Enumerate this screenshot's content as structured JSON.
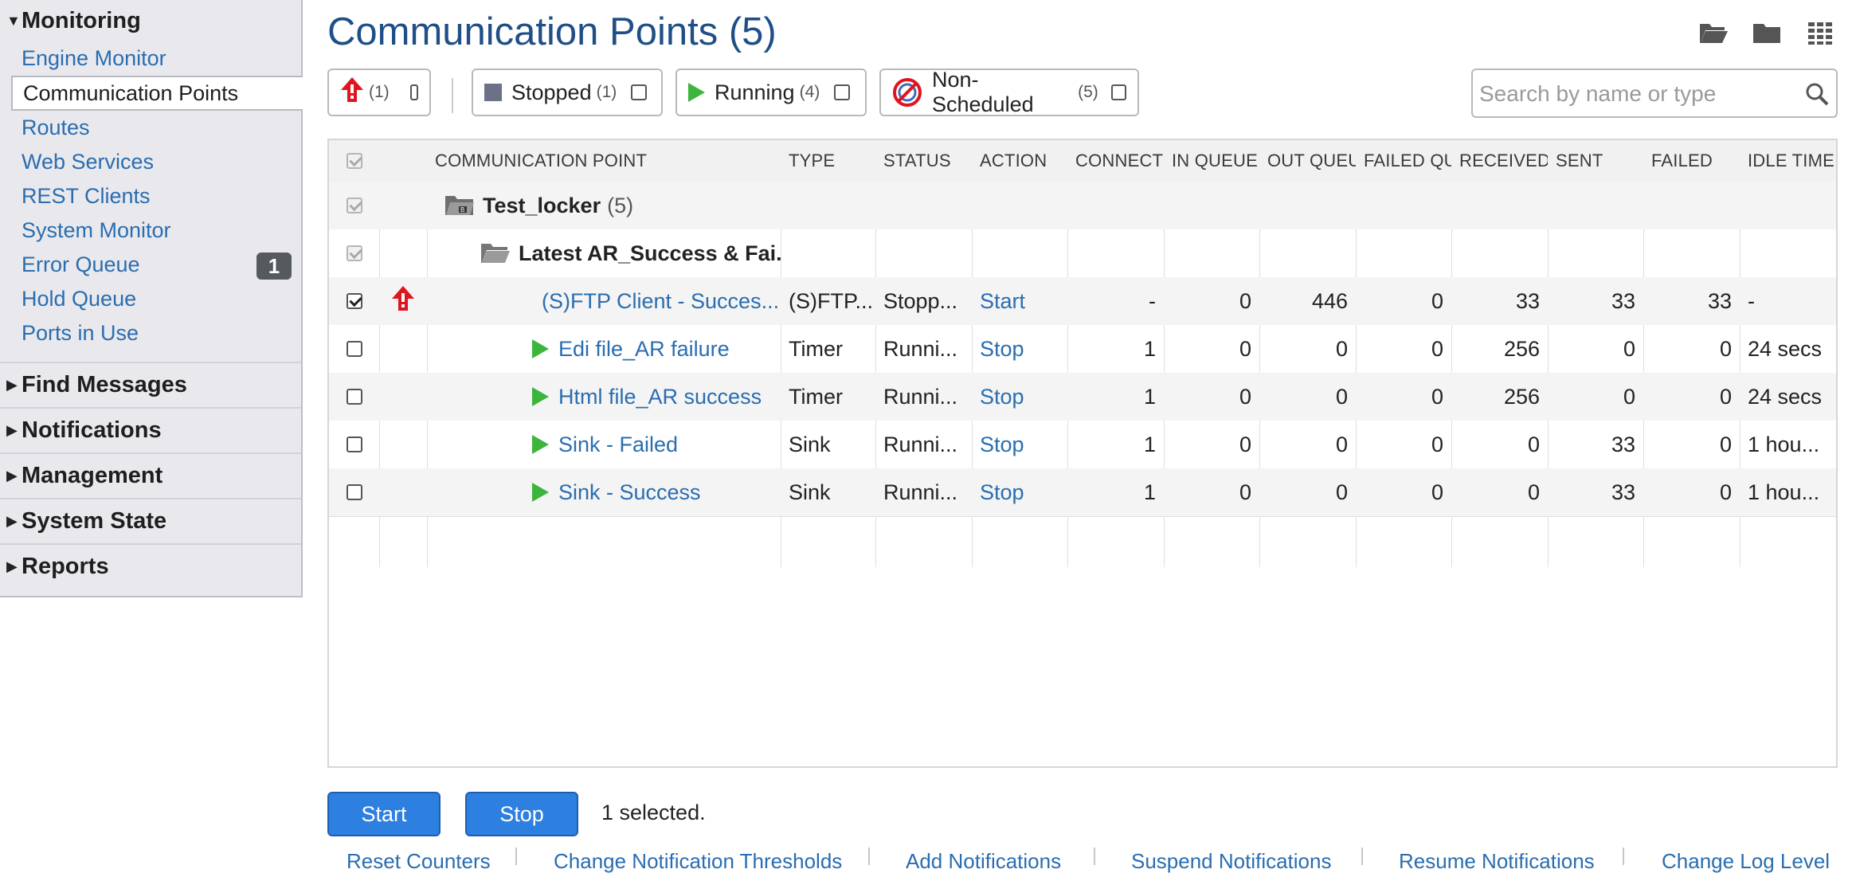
{
  "sidebar": {
    "monitoring": {
      "label": "Monitoring",
      "items": [
        {
          "label": "Engine Monitor"
        },
        {
          "label": "Communication Points"
        },
        {
          "label": "Routes"
        },
        {
          "label": "Web Services"
        },
        {
          "label": "REST Clients"
        },
        {
          "label": "System Monitor"
        },
        {
          "label": "Error Queue",
          "badge": "1"
        },
        {
          "label": "Hold Queue"
        },
        {
          "label": "Ports in Use"
        }
      ]
    },
    "sections": [
      {
        "label": "Find Messages"
      },
      {
        "label": "Notifications"
      },
      {
        "label": "Management"
      },
      {
        "label": "System State"
      },
      {
        "label": "Reports"
      }
    ]
  },
  "main": {
    "title": "Communication Points (5)",
    "top_icons": [
      "open-folder-icon",
      "folder-icon",
      "grid-view-icon"
    ],
    "filters": {
      "alert": {
        "count": "(1)"
      },
      "stopped": {
        "label": "Stopped",
        "count": "(1)"
      },
      "running": {
        "label": "Running",
        "count": "(4)"
      },
      "non_scheduled": {
        "label": "Non-Scheduled",
        "count": "(5)"
      }
    },
    "search": {
      "placeholder": "Search by name or type",
      "value": ""
    },
    "columns": [
      "COMMUNICATION POINT",
      "TYPE",
      "STATUS",
      "ACTION",
      "CONNECTI",
      "IN QUEUE",
      "OUT QUEU",
      "FAILED QU",
      "RECEIVED",
      "SENT",
      "FAILED",
      "IDLE TIME"
    ],
    "groups": [
      {
        "name": "Test_locker",
        "count": "(5)"
      },
      {
        "name": "Latest AR_Success & Fai..."
      }
    ],
    "rows": [
      {
        "name": "(S)FTP Client - Succes...",
        "type": "(S)FTP...",
        "status": "Stopp...",
        "action": "Start",
        "connections": "-",
        "in_queue": "0",
        "out_queue": "446",
        "failed_queue": "0",
        "received": "33",
        "sent": "33",
        "failed": "33",
        "idle": "-",
        "state": "stopped",
        "alert": true,
        "checked": true
      },
      {
        "name": "Edi file_AR failure",
        "type": "Timer",
        "status": "Runni...",
        "action": "Stop",
        "connections": "1",
        "in_queue": "0",
        "out_queue": "0",
        "failed_queue": "0",
        "received": "256",
        "sent": "0",
        "failed": "0",
        "idle": "24 secs",
        "state": "running",
        "alert": false,
        "checked": false
      },
      {
        "name": "Html file_AR success",
        "type": "Timer",
        "status": "Runni...",
        "action": "Stop",
        "connections": "1",
        "in_queue": "0",
        "out_queue": "0",
        "failed_queue": "0",
        "received": "256",
        "sent": "0",
        "failed": "0",
        "idle": "24 secs",
        "state": "running",
        "alert": false,
        "checked": false
      },
      {
        "name": "Sink - Failed",
        "type": "Sink",
        "status": "Runni...",
        "action": "Stop",
        "connections": "1",
        "in_queue": "0",
        "out_queue": "0",
        "failed_queue": "0",
        "received": "0",
        "sent": "33",
        "failed": "0",
        "idle": "1 hou...",
        "state": "running",
        "alert": false,
        "checked": false
      },
      {
        "name": "Sink - Success",
        "type": "Sink",
        "status": "Runni...",
        "action": "Stop",
        "connections": "1",
        "in_queue": "0",
        "out_queue": "0",
        "failed_queue": "0",
        "received": "0",
        "sent": "33",
        "failed": "0",
        "idle": "1 hou...",
        "state": "running",
        "alert": false,
        "checked": false
      }
    ],
    "buttons": {
      "start": "Start",
      "stop": "Stop"
    },
    "selected_status": "1 selected.",
    "bottom_links": [
      "Reset Counters",
      "Change Notification Thresholds",
      "Add Notifications",
      "Suspend Notifications",
      "Resume Notifications",
      "Change Log Level"
    ],
    "colors": {
      "accent": "#2d7fe0",
      "link": "#2a6db0",
      "running": "#3db53d",
      "stopped": "#6b7287",
      "alert": "#e0141e",
      "title": "#1f4f86"
    }
  }
}
